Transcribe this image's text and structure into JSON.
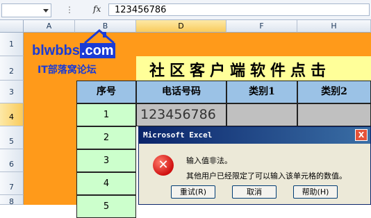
{
  "formula_bar": {
    "fx_label": "fx",
    "value": "123456786"
  },
  "columns": [
    "A",
    "B",
    "D",
    "F",
    "H"
  ],
  "rows": [
    "1",
    "2",
    "3",
    "4",
    "5",
    "6",
    "7",
    "8"
  ],
  "logo": {
    "main": "blwbbs",
    "suffix": ".com",
    "tagline": "IT部落窝论坛"
  },
  "sheet": {
    "title": "社区客户端软件点击",
    "headers": [
      "序号",
      "电话号码",
      "类别1",
      "类别2"
    ],
    "row_numbers": [
      "1",
      "2",
      "3",
      "4",
      "5"
    ],
    "phone_value": "123456786"
  },
  "dialog": {
    "title": "Microsoft Excel",
    "close": "X",
    "message_1": "输入值非法。",
    "message_2": "其他用户已经限定了可以输入该单元格的数值。",
    "buttons": [
      "重试(R)",
      "取消",
      "帮助(H)"
    ]
  },
  "colors": {
    "orange": "#ff9a1a",
    "yellow": "#ffff99",
    "header_blue": "#9bc2e6",
    "row_green": "#ccffcc"
  }
}
